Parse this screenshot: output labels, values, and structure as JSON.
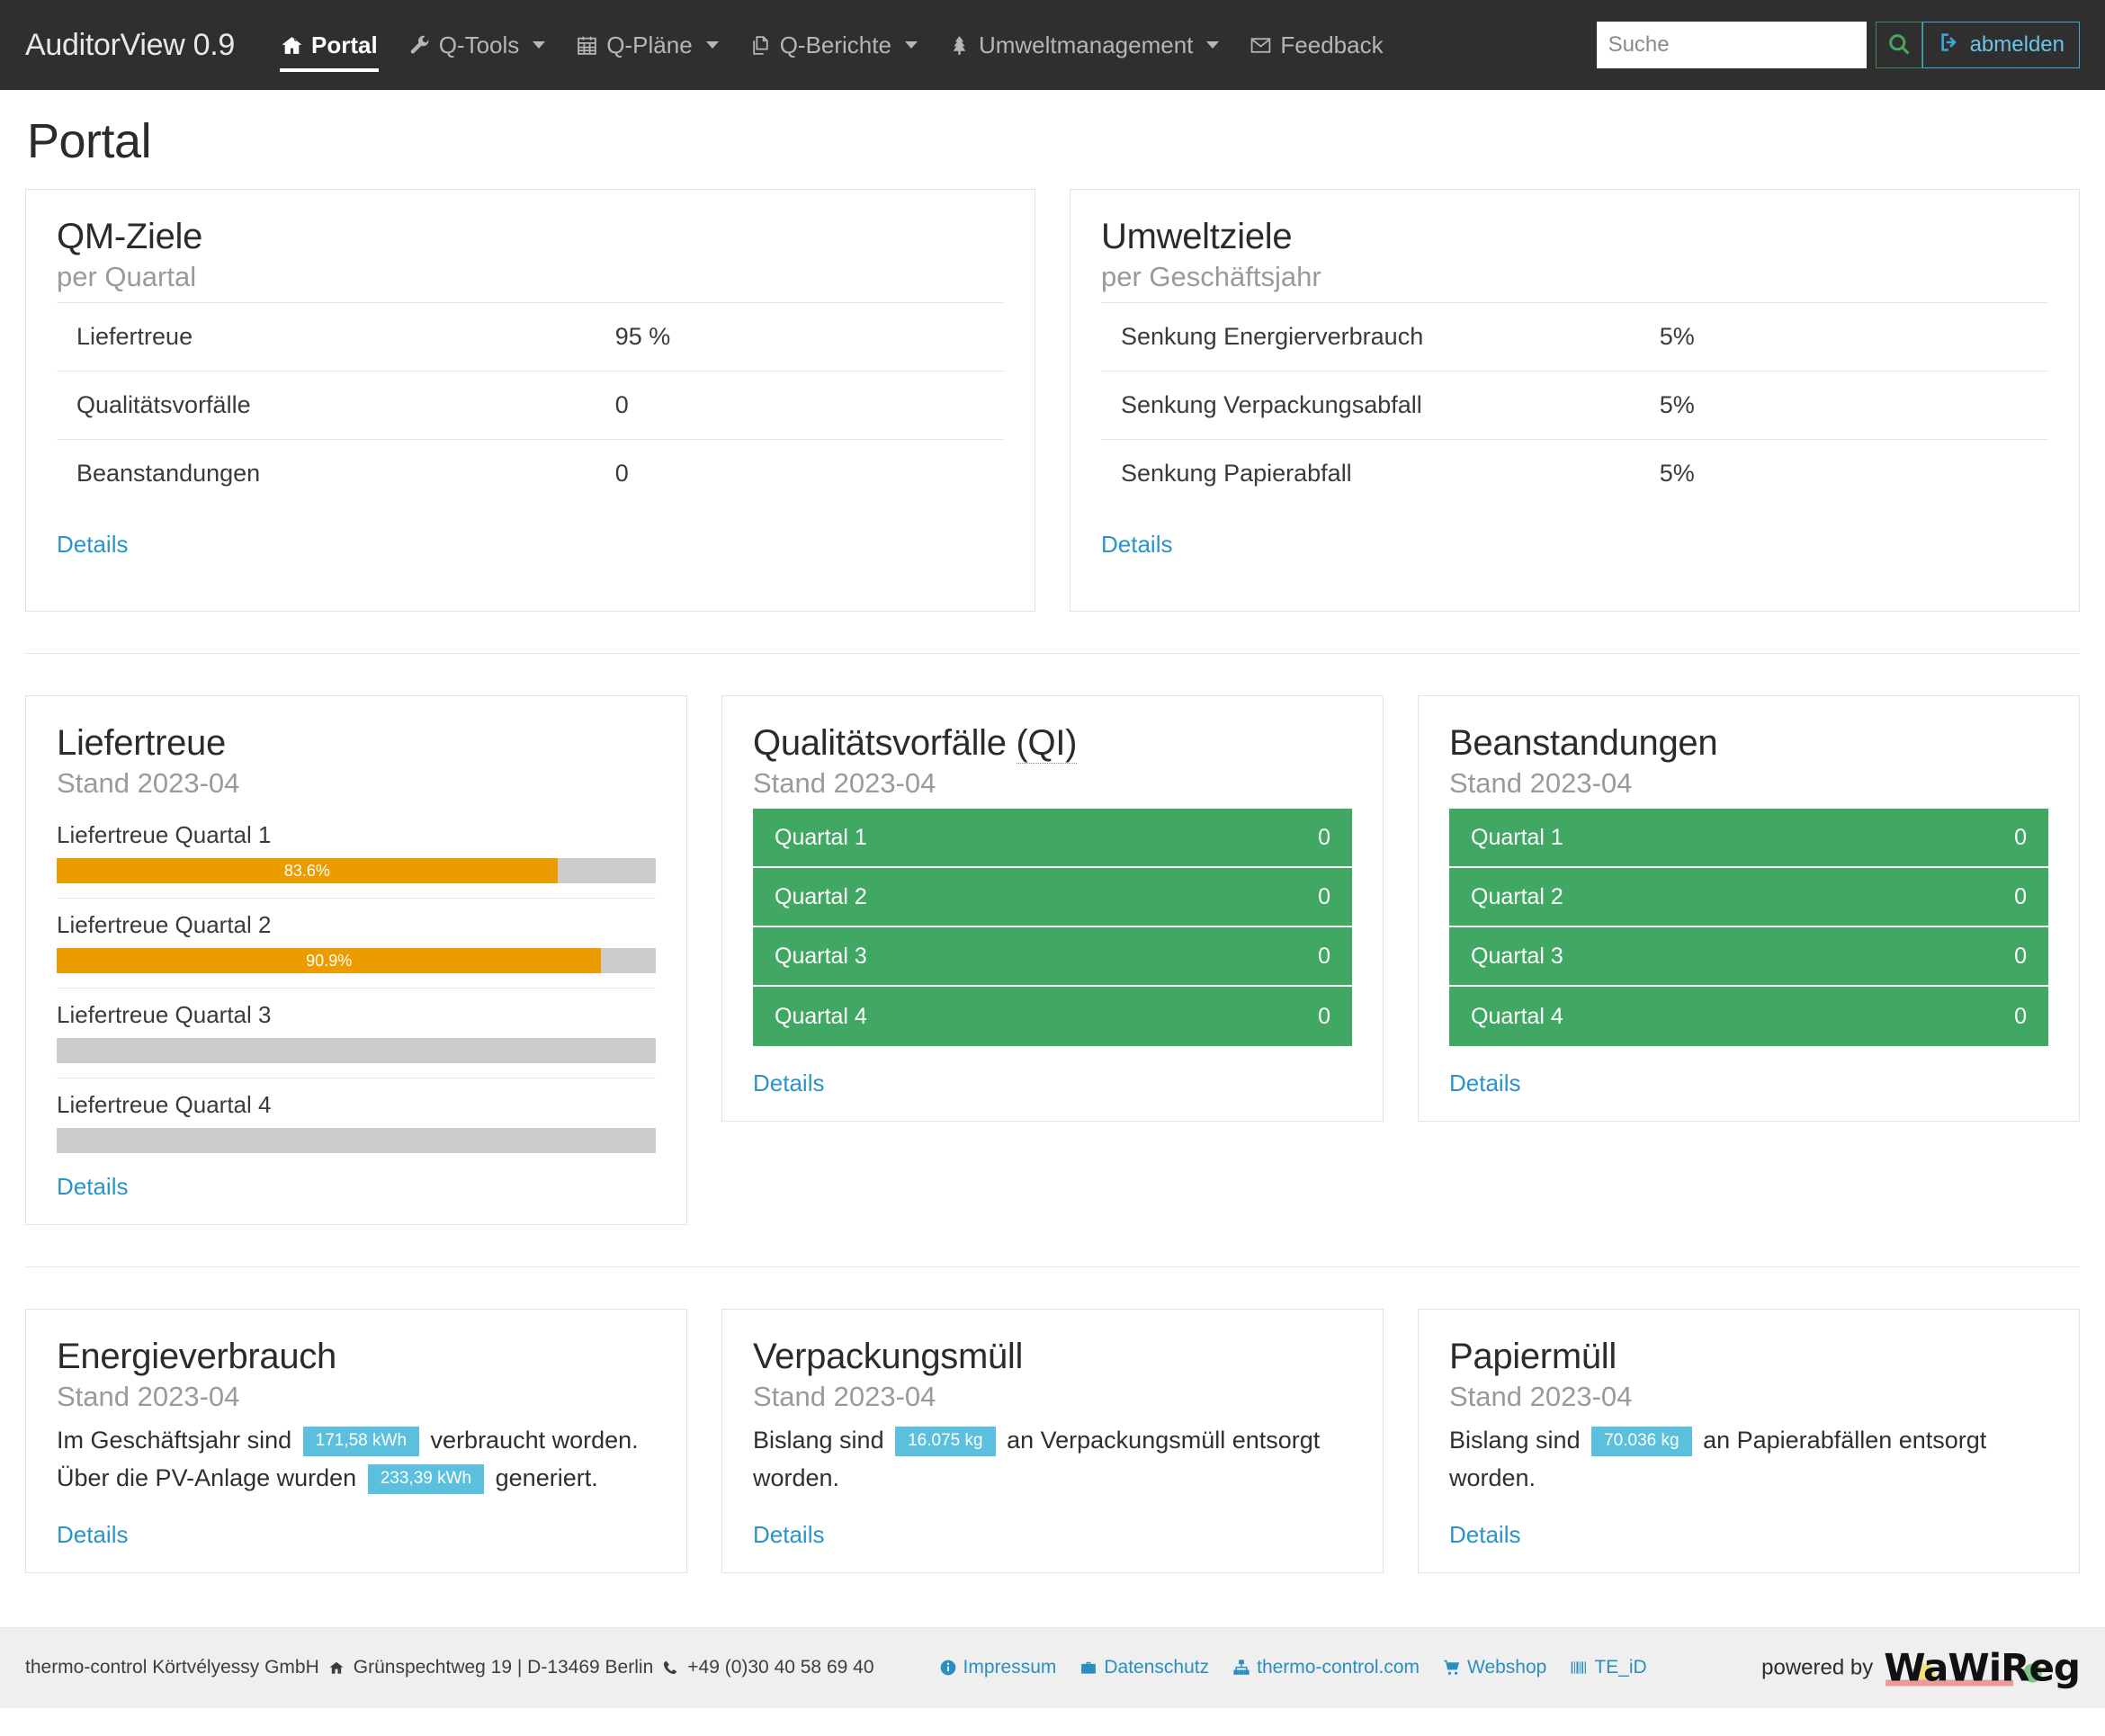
{
  "navbar": {
    "brand": "AuditorView 0.9",
    "items": [
      {
        "label": "Portal",
        "icon": "home-icon",
        "active": true,
        "caret": false
      },
      {
        "label": "Q-Tools",
        "icon": "wrench-icon",
        "active": false,
        "caret": true
      },
      {
        "label": "Q-Pläne",
        "icon": "calendar-icon",
        "active": false,
        "caret": true
      },
      {
        "label": "Q-Berichte",
        "icon": "copy-files-icon",
        "active": false,
        "caret": true
      },
      {
        "label": "Umweltmanagement",
        "icon": "tree-icon",
        "active": false,
        "caret": true
      },
      {
        "label": "Feedback",
        "icon": "envelope-check-icon",
        "active": false,
        "caret": false
      }
    ],
    "search": {
      "placeholder": "Suche",
      "value": ""
    },
    "search_button": {
      "icon": "search-icon",
      "accent": "#3c8c53"
    },
    "logout_button": {
      "label": "abmelden",
      "icon": "sign-out-icon",
      "accent": "#3aa7d4"
    }
  },
  "page": {
    "title": "Portal"
  },
  "cards": {
    "qm_ziele": {
      "title": "QM-Ziele",
      "subtitle": "per Quartal",
      "rows": [
        {
          "label": "Liefertreue",
          "value": "95 %"
        },
        {
          "label": "Qualitätsvorfälle",
          "value": "0"
        },
        {
          "label": "Beanstandungen",
          "value": "0"
        }
      ],
      "details": "Details"
    },
    "umweltziele": {
      "title": "Umweltziele",
      "subtitle": "per Geschäftsjahr",
      "rows": [
        {
          "label": "Senkung Energierverbrauch",
          "value": "5%"
        },
        {
          "label": "Senkung Verpackungsabfall",
          "value": "5%"
        },
        {
          "label": "Senkung Papierabfall",
          "value": "5%"
        }
      ],
      "details": "Details"
    },
    "liefertreue": {
      "title": "Liefertreue",
      "subtitle": "Stand 2023-04",
      "bars": [
        {
          "label": "Liefertreue Quartal 1",
          "text": "83.6%",
          "percent": 83.6
        },
        {
          "label": "Liefertreue Quartal 2",
          "text": "90.9%",
          "percent": 90.9
        },
        {
          "label": "Liefertreue Quartal 3",
          "text": "",
          "percent": 0
        },
        {
          "label": "Liefertreue Quartal 4",
          "text": "",
          "percent": 0
        }
      ],
      "details": "Details"
    },
    "qualitaetsvorfaelle": {
      "title": "Qualitätsvorfälle",
      "title_abbr": "(QI)",
      "subtitle": "Stand 2023-04",
      "rows": [
        {
          "label": "Quartal 1",
          "value": "0"
        },
        {
          "label": "Quartal 2",
          "value": "0"
        },
        {
          "label": "Quartal 3",
          "value": "0"
        },
        {
          "label": "Quartal 4",
          "value": "0"
        }
      ],
      "details": "Details"
    },
    "beanstandungen": {
      "title": "Beanstandungen",
      "subtitle": "Stand 2023-04",
      "rows": [
        {
          "label": "Quartal 1",
          "value": "0"
        },
        {
          "label": "Quartal 2",
          "value": "0"
        },
        {
          "label": "Quartal 3",
          "value": "0"
        },
        {
          "label": "Quartal 4",
          "value": "0"
        }
      ],
      "details": "Details"
    },
    "energieverbrauch": {
      "title": "Energieverbrauch",
      "subtitle": "Stand 2023-04",
      "text_1": "Im Geschäftsjahr sind",
      "badge_1": "171,58 kWh",
      "text_2": "verbraucht worden. Über die PV-Anlage wurden",
      "badge_2": "233,39 kWh",
      "text_3": "generiert.",
      "details": "Details"
    },
    "verpackungsmuell": {
      "title": "Verpackungsmüll",
      "subtitle": "Stand 2023-04",
      "text_1": "Bislang sind",
      "badge_1": "16.075 kg",
      "text_2": "an Verpackungsmüll entsorgt worden.",
      "details": "Details"
    },
    "papiermuell": {
      "title": "Papiermüll",
      "subtitle": "Stand 2023-04",
      "text_1": "Bislang sind",
      "badge_1": "70.036 kg",
      "text_2": "an Papierabfällen entsorgt worden.",
      "details": "Details"
    }
  },
  "footer": {
    "company": "thermo-control Körtvélyessy GmbH",
    "address": "Grünspechtweg 19 | D-13469 Berlin",
    "phone": "+49 (0)30 40 58 69 40",
    "links": [
      {
        "label": "Impressum",
        "icon": "info-circle-icon"
      },
      {
        "label": "Datenschutz",
        "icon": "briefcase-icon"
      },
      {
        "label": "thermo-control.com",
        "icon": "sitemap-icon"
      },
      {
        "label": "Webshop",
        "icon": "shopping-cart-icon"
      },
      {
        "label": "TE_iD",
        "icon": "barcode-icon"
      }
    ],
    "powered_by": "powered by",
    "logo_text": "WaWiReg"
  },
  "colors": {
    "navbar_bg": "#2f2f2f",
    "progress_orange": "#ed9c00",
    "progress_track": "#cccccc",
    "status_green": "#41a863",
    "badge_blue": "#5bc0de",
    "link_blue": "#2a94c9"
  }
}
